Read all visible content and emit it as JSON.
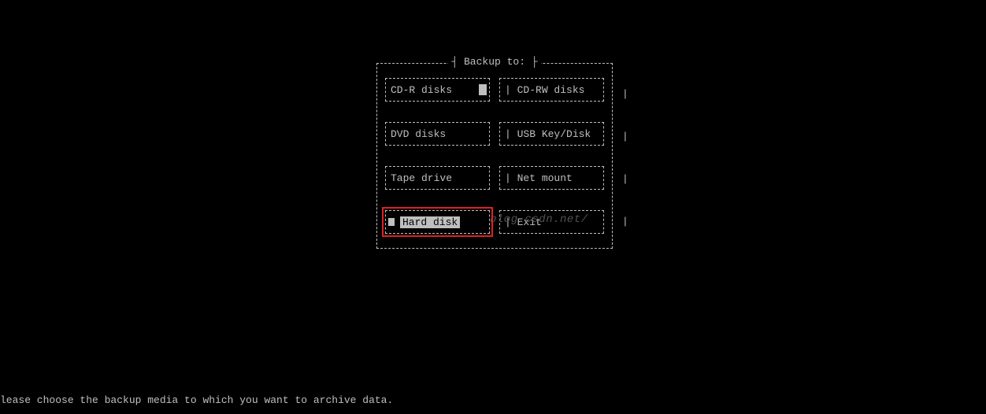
{
  "dialog": {
    "title": "Backup to:",
    "options": [
      {
        "label": "CD-R disks",
        "variant": "left",
        "selected": false,
        "cursor": true
      },
      {
        "label": "CD-RW disks",
        "variant": "right",
        "selected": false,
        "cursor": false
      },
      {
        "label": "DVD disks",
        "variant": "left",
        "selected": false,
        "cursor": false
      },
      {
        "label": "USB Key/Disk",
        "variant": "right",
        "selected": false,
        "cursor": false
      },
      {
        "label": "Tape drive",
        "variant": "left",
        "selected": false,
        "cursor": false
      },
      {
        "label": "Net mount",
        "variant": "right",
        "selected": false,
        "cursor": false
      },
      {
        "label": "Hard disk",
        "variant": "left",
        "selected": true,
        "cursor": false
      },
      {
        "label": "Exit",
        "variant": "right",
        "selected": false,
        "cursor": false
      }
    ]
  },
  "footer": "lease choose the backup media to which you want to archive data.",
  "watermark": "blog.csdn.net/",
  "side_glyph": "|"
}
